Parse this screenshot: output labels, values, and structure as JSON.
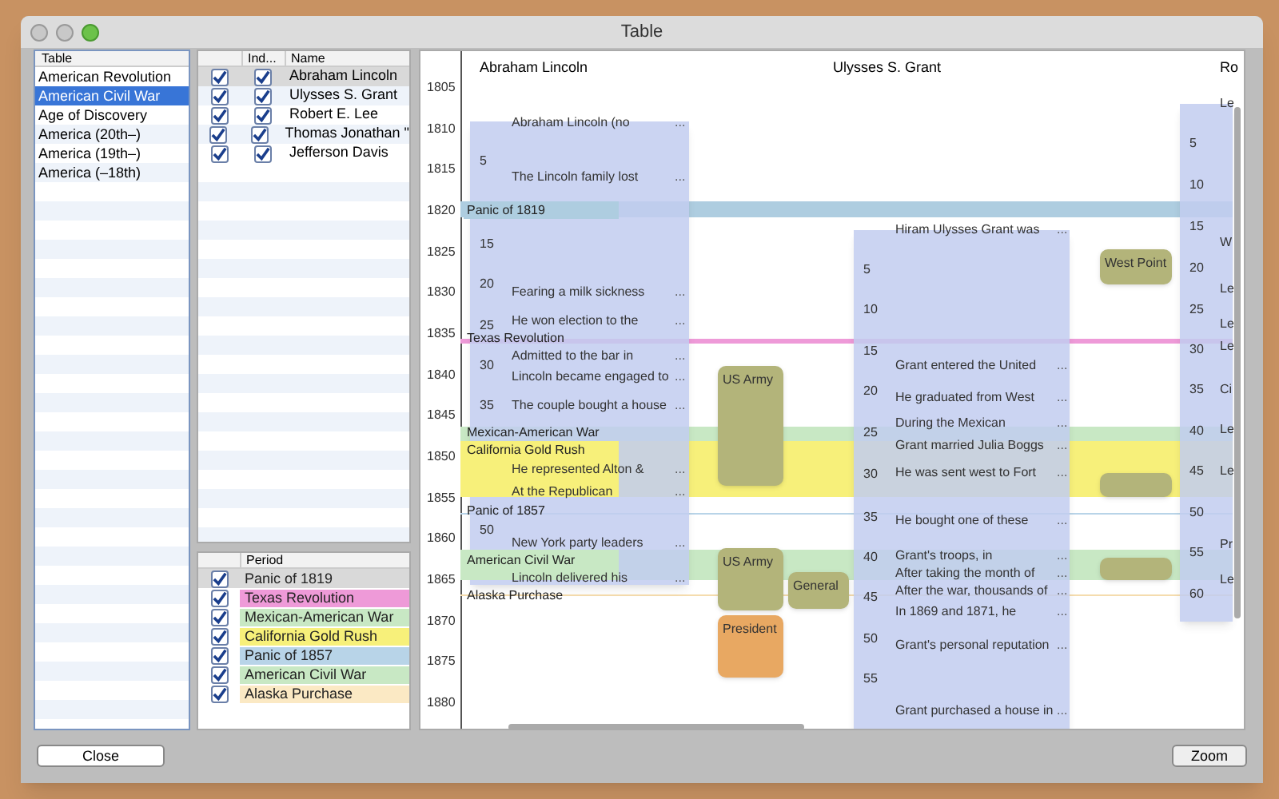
{
  "window": {
    "title": "Table"
  },
  "tables": {
    "column": "Table",
    "items": [
      {
        "label": "American Revolution",
        "selected": false
      },
      {
        "label": "American Civil War",
        "selected": true
      },
      {
        "label": "Age of Discovery",
        "selected": false
      },
      {
        "label": "America (20th–)",
        "selected": false
      },
      {
        "label": "America (19th–)",
        "selected": false
      },
      {
        "label": "America (–18th)",
        "selected": false
      }
    ]
  },
  "people": {
    "columns": [
      "Ind...",
      "Name"
    ],
    "rows": [
      {
        "shown": true,
        "ind": true,
        "name": "Abraham  Lincoln",
        "selected": true
      },
      {
        "shown": true,
        "ind": true,
        "name": "Ulysses S.  Grant",
        "selected": false
      },
      {
        "shown": true,
        "ind": true,
        "name": "Robert E.  Lee",
        "selected": false
      },
      {
        "shown": true,
        "ind": true,
        "name": "Thomas Jonathan \"",
        "selected": false
      },
      {
        "shown": true,
        "ind": true,
        "name": "Jefferson  Davis",
        "selected": false
      }
    ]
  },
  "periods": {
    "column": "Period",
    "rows": [
      {
        "checked": true,
        "name": "Panic of 1819",
        "selected": true
      },
      {
        "checked": true,
        "name": "Texas Revolution",
        "color": "#ee9ad8",
        "selected": false
      },
      {
        "checked": true,
        "name": "Mexican-American War",
        "color": "#c8e8c4",
        "selected": false
      },
      {
        "checked": true,
        "name": "California Gold Rush",
        "color": "#f7f07a",
        "selected": false
      },
      {
        "checked": true,
        "name": "Panic of 1857",
        "color": "#b8d4e8",
        "selected": false
      },
      {
        "checked": true,
        "name": "American Civil War",
        "color": "#c8e8c4",
        "selected": false
      },
      {
        "checked": true,
        "name": "Alaska Purchase",
        "color": "#fbe9c4",
        "selected": false
      }
    ]
  },
  "timeline": {
    "years": [
      "1805",
      "1810",
      "1815",
      "1820",
      "1825",
      "1830",
      "1835",
      "1840",
      "1845",
      "1850",
      "1855",
      "1860",
      "1865",
      "1870",
      "1875",
      "1880"
    ],
    "headers": [
      "Abraham  Lincoln",
      "Ulysses S.  Grant",
      "Ro"
    ],
    "bands": [
      {
        "name": "Panic of 1819",
        "color": "#aecde0"
      },
      {
        "name": "Texas Revolution",
        "color": "#ee9ad8"
      },
      {
        "name": "Mexican-American War",
        "color": "#c8e8c4"
      },
      {
        "name": "California Gold Rush",
        "color": "#f7f07a"
      },
      {
        "name": "Panic of 1857",
        "color": "#b8d4e8"
      },
      {
        "name": "American Civil War",
        "color": "#c8e8c4"
      },
      {
        "name": "Alaska Purchase",
        "color": "#f5dcae"
      }
    ],
    "lanes": [
      {
        "numbers": [
          "5",
          "15",
          "20",
          "25",
          "30",
          "35",
          "50"
        ],
        "entries": [
          {
            "text": "Abraham Lincoln (no",
            "more": "..."
          },
          {
            "text": "The Lincoln family lost",
            "more": "..."
          },
          {
            "text": "Fearing a milk sickness",
            "more": "..."
          },
          {
            "text": "He won election to the",
            "more": "..."
          },
          {
            "text": "Admitted to the bar in",
            "more": "..."
          },
          {
            "text": "Lincoln became engaged to",
            "more": "..."
          },
          {
            "text": "The couple bought a house",
            "more": "..."
          },
          {
            "text": "He represented Alton &",
            "more": "..."
          },
          {
            "text": "At the Republican",
            "more": "..."
          },
          {
            "text": "New York party leaders",
            "more": "..."
          },
          {
            "text": "Lincoln delivered his",
            "more": "..."
          }
        ]
      },
      {
        "numbers": [
          "5",
          "10",
          "15",
          "20",
          "25",
          "30",
          "35",
          "40",
          "45",
          "50",
          "55"
        ],
        "entries": [
          {
            "text": "Hiram Ulysses Grant was",
            "more": "..."
          },
          {
            "text": "Grant entered the United",
            "more": "..."
          },
          {
            "text": "He graduated from West",
            "more": "..."
          },
          {
            "text": "During the Mexican",
            "more": "..."
          },
          {
            "text": "Grant married Julia Boggs",
            "more": "..."
          },
          {
            "text": "He was sent west to Fort",
            "more": "..."
          },
          {
            "text": "He bought one of these",
            "more": "..."
          },
          {
            "text": "Grant's troops, in",
            "more": "..."
          },
          {
            "text": "After taking the month of",
            "more": "..."
          },
          {
            "text": "After the war, thousands of",
            "more": "..."
          },
          {
            "text": "In 1869 and 1871, he",
            "more": "..."
          },
          {
            "text": "Grant's personal reputation",
            "more": "..."
          },
          {
            "text": "Grant purchased a house in",
            "more": "..."
          }
        ]
      },
      {
        "numbers": [
          "5",
          "10",
          "15",
          "20",
          "25",
          "30",
          "35",
          "40",
          "45",
          "50",
          "55",
          "60"
        ],
        "entries": [
          {
            "text": "Le"
          },
          {
            "text": "W"
          },
          {
            "text": "Le"
          },
          {
            "text": "Le"
          },
          {
            "text": "Le"
          },
          {
            "text": "Ci"
          },
          {
            "text": "Le"
          },
          {
            "text": "Le"
          },
          {
            "text": "Pr"
          },
          {
            "text": "Le"
          }
        ]
      }
    ],
    "badges": [
      {
        "text": "US Army",
        "color": "#b3b47a"
      },
      {
        "text": "US Army",
        "color": "#b3b47a"
      },
      {
        "text": "General",
        "color": "#b3b47a"
      },
      {
        "text": "President",
        "color": "#e8a862"
      },
      {
        "text": "West Point",
        "color": "#b3b47a"
      },
      {
        "color": "#b3b47a"
      },
      {
        "color": "#b3b47a"
      }
    ]
  },
  "buttons": {
    "close": "Close",
    "zoom": "Zoom"
  }
}
